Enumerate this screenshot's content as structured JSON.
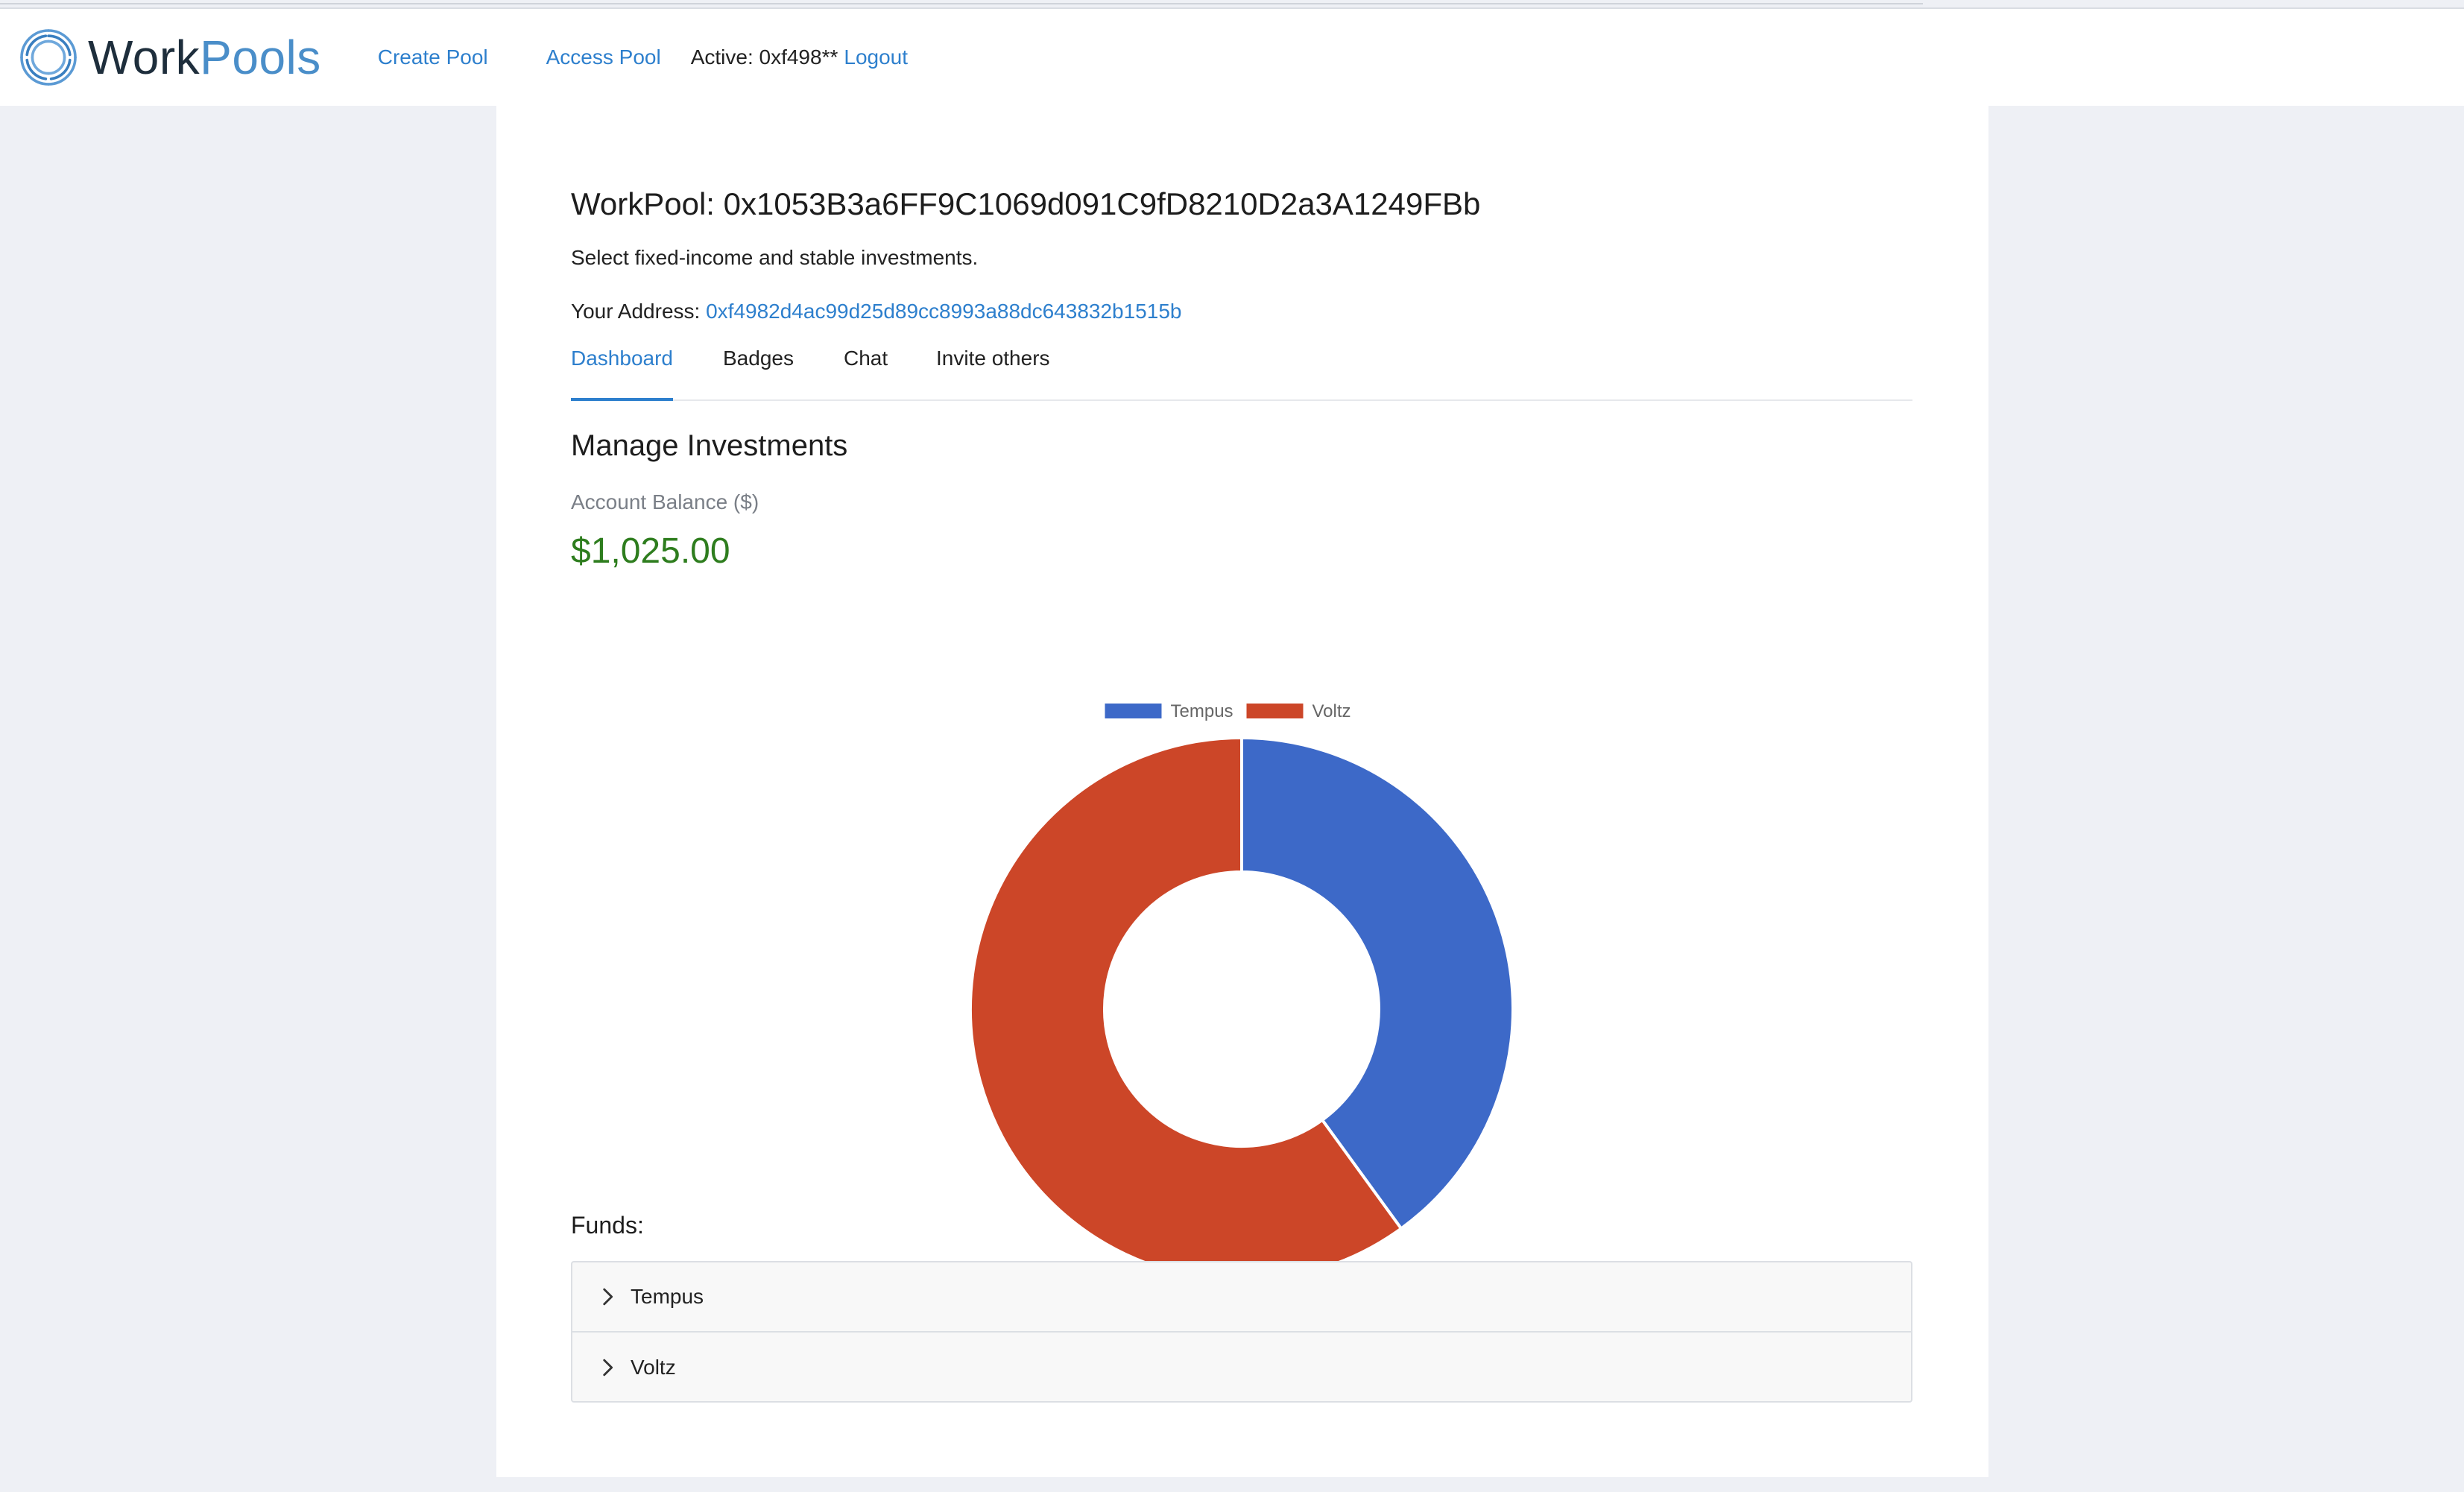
{
  "header": {
    "logo_work": "Work",
    "logo_pools": "Pools",
    "nav": [
      {
        "label": "Create Pool"
      },
      {
        "label": "Access Pool"
      }
    ],
    "active_text": "Active: 0xf498**",
    "logout_label": "Logout"
  },
  "pool": {
    "title": "WorkPool: 0x1053B3a6FF9C1069d091C9fD8210D2a3A1249FBb",
    "description": "Select fixed-income and stable investments.",
    "address_label": "Your Address:",
    "address_value": "0xf4982d4ac99d25d89cc8993a88dc643832b1515b"
  },
  "tabs": [
    {
      "label": "Dashboard",
      "active": true
    },
    {
      "label": "Badges",
      "active": false
    },
    {
      "label": "Chat",
      "active": false
    },
    {
      "label": "Invite others",
      "active": false
    }
  ],
  "investments": {
    "title": "Manage Investments",
    "balance_label": "Account Balance ($)",
    "balance_value": "$1,025.00"
  },
  "chart_data": {
    "type": "pie",
    "title": "",
    "categories": [
      "Tempus",
      "Voltz"
    ],
    "values": [
      40,
      60
    ],
    "colors": [
      "#3d69c8",
      "#cc4628"
    ],
    "donut": true,
    "legend_position": "top"
  },
  "funds": {
    "label": "Funds:",
    "items": [
      {
        "label": "Tempus",
        "icon": "chevron-right-icon"
      },
      {
        "label": "Voltz",
        "icon": "chevron-right-icon"
      }
    ]
  }
}
